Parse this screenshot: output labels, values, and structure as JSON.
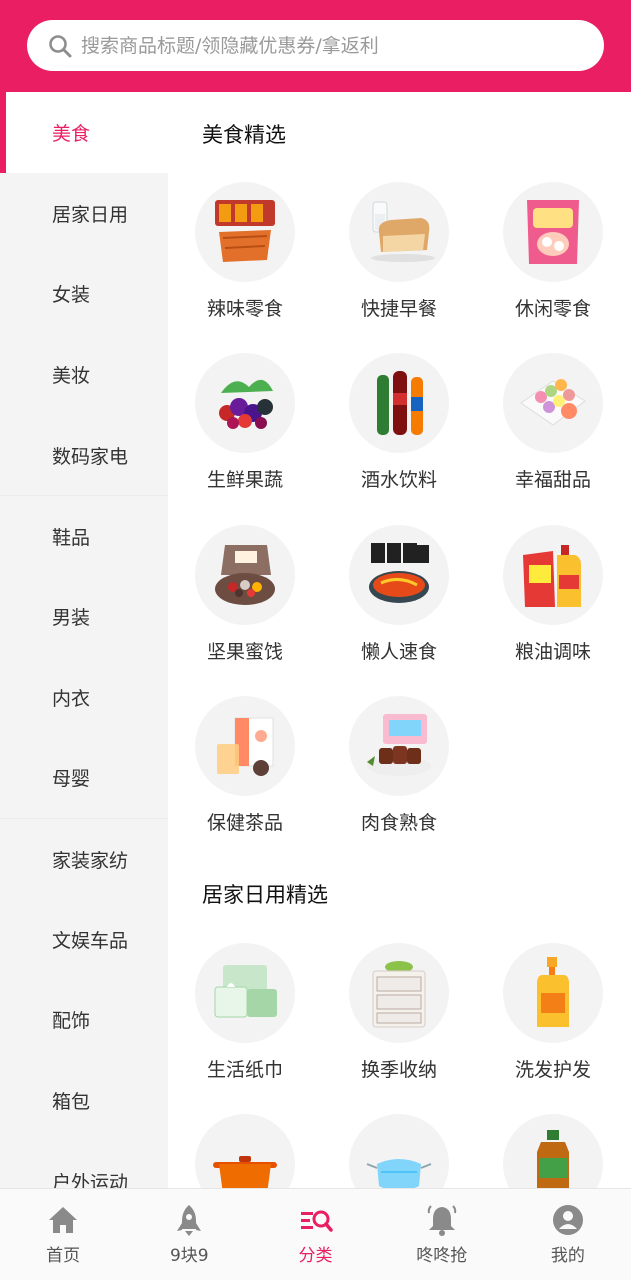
{
  "colors": {
    "accent": "#e91e63",
    "sidebar_bg": "#f4f4f4",
    "icon_gray": "#888888"
  },
  "search": {
    "placeholder": "搜索商品标题/领隐藏优惠券/拿返利",
    "icon": "search-icon"
  },
  "sidebar": {
    "items": [
      {
        "label": "美食",
        "active": true
      },
      {
        "label": "居家日用"
      },
      {
        "label": "女装"
      },
      {
        "label": "美妆"
      },
      {
        "label": "数码家电"
      },
      {
        "label": "鞋品"
      },
      {
        "label": "男装"
      },
      {
        "label": "内衣"
      },
      {
        "label": "母婴"
      },
      {
        "label": "家装家纺"
      },
      {
        "label": "文娱车品"
      },
      {
        "label": "配饰"
      },
      {
        "label": "箱包"
      },
      {
        "label": "户外运动"
      }
    ]
  },
  "sections": [
    {
      "title": "美食精选",
      "items": [
        {
          "label": "辣味零食"
        },
        {
          "label": "快捷早餐"
        },
        {
          "label": "休闲零食"
        },
        {
          "label": "生鲜果蔬"
        },
        {
          "label": "酒水饮料"
        },
        {
          "label": "幸福甜品"
        },
        {
          "label": "坚果蜜饯"
        },
        {
          "label": "懒人速食"
        },
        {
          "label": "粮油调味"
        },
        {
          "label": "保健茶品"
        },
        {
          "label": "肉食熟食"
        }
      ]
    },
    {
      "title": "居家日用精选",
      "items": [
        {
          "label": "生活纸巾"
        },
        {
          "label": "换季收纳"
        },
        {
          "label": "洗发护发"
        },
        {
          "label": ""
        },
        {
          "label": ""
        },
        {
          "label": ""
        }
      ]
    }
  ],
  "tabbar": {
    "tabs": [
      {
        "label": "首页",
        "icon": "home-icon"
      },
      {
        "label": "9块9",
        "icon": "rocket-icon"
      },
      {
        "label": "分类",
        "icon": "category-search-icon",
        "active": true
      },
      {
        "label": "咚咚抢",
        "icon": "bell-icon"
      },
      {
        "label": "我的",
        "icon": "user-icon"
      }
    ]
  }
}
